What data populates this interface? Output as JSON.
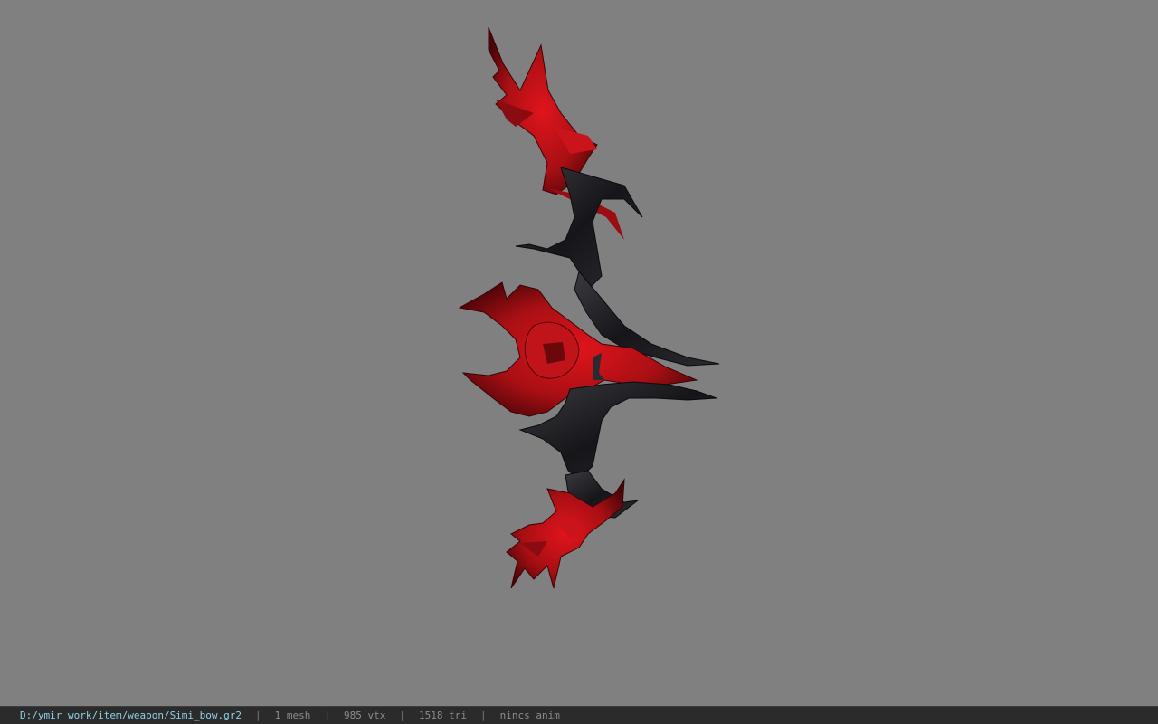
{
  "viewer": {
    "background_color": "#808080",
    "model_primary_color": "#b3141a",
    "model_secondary_color": "#1e1e22"
  },
  "status_bar": {
    "path": "D:/ymir work/item/weapon/Simi_bow.gr2",
    "separator": "|",
    "mesh": "1 mesh",
    "vertices": "985 vtx",
    "triangles": "1518 tri",
    "anim": "nincs anim"
  }
}
